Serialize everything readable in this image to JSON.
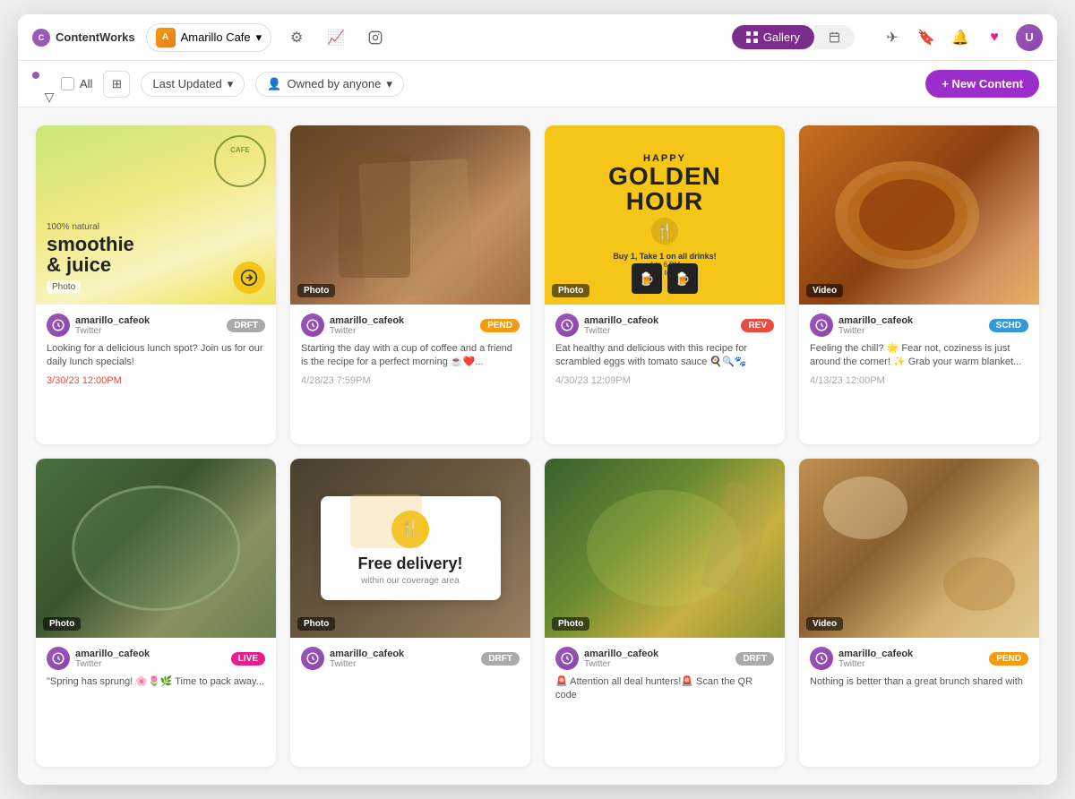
{
  "app": {
    "brand": "ContentWorks",
    "client": "Amarillo Cafe",
    "view_gallery": "Gallery",
    "view_calendar": "Calendar"
  },
  "filter_bar": {
    "all_label": "All",
    "sort_label": "Last Updated",
    "owner_label": "Owned by anyone",
    "new_content_label": "+ New Content"
  },
  "cards": [
    {
      "id": 1,
      "type": "Photo",
      "design": "smoothie",
      "username": "amarillo_cafeok",
      "platform": "Twitter",
      "status": "DRFT",
      "status_class": "status-drft",
      "caption": "Looking for a delicious lunch spot? Join us for our daily lunch specials!",
      "date": "3/30/23 12:00PM",
      "date_red": true
    },
    {
      "id": 2,
      "type": "Photo",
      "design": "cafe",
      "username": "amarillo_cafeok",
      "platform": "Twitter",
      "status": "PEND",
      "status_class": "status-pend",
      "caption": "Starting the day with a cup of coffee and a friend is the recipe for a perfect morning ☕❤️...",
      "date": "4/28/23 7:59PM",
      "date_red": false
    },
    {
      "id": 3,
      "type": "Photo",
      "design": "golden",
      "username": "amarillo_cafeok",
      "platform": "Twitter",
      "status": "REV",
      "status_class": "status-rev",
      "caption": "Eat healthy and delicious with this recipe for scrambled eggs with tomato sauce 🍳🔍🐾",
      "date": "4/30/23 12:09PM",
      "date_red": false
    },
    {
      "id": 4,
      "type": "Video",
      "design": "coffee",
      "username": "amarillo_cafeok",
      "platform": "Twitter",
      "status": "SCHD",
      "status_class": "status-schd",
      "caption": "Feeling the chill? 🌟 Fear not, coziness is just around the corner! ✨ Grab your warm blanket...",
      "date": "4/13/23 12:00PM",
      "date_red": false
    },
    {
      "id": 5,
      "type": "Photo",
      "design": "foodplate",
      "username": "amarillo_cafeok",
      "platform": "Twitter",
      "status": "LIVE",
      "status_class": "status-live",
      "caption": "\"Spring has sprung! 🌸🌷🌿 Time to pack away...",
      "date": "",
      "date_red": false
    },
    {
      "id": 6,
      "type": "Photo",
      "design": "delivery",
      "username": "amarillo_cafeok",
      "platform": "Twitter",
      "status": "DRFT",
      "status_class": "status-drft",
      "caption": "",
      "date": "",
      "date_red": false
    },
    {
      "id": 7,
      "type": "Photo",
      "design": "salad",
      "username": "amarillo_cafeok",
      "platform": "Twitter",
      "status": "DRFT",
      "status_class": "status-drft",
      "caption": "🚨 Attention all deal hunters!🚨 Scan the QR code",
      "date": "",
      "date_red": false
    },
    {
      "id": 8,
      "type": "Video",
      "design": "brunch",
      "username": "amarillo_cafeok",
      "platform": "Twitter",
      "status": "PEND",
      "status_class": "status-pend",
      "caption": "Nothing is better than a great brunch shared with",
      "date": "",
      "date_red": false
    }
  ]
}
